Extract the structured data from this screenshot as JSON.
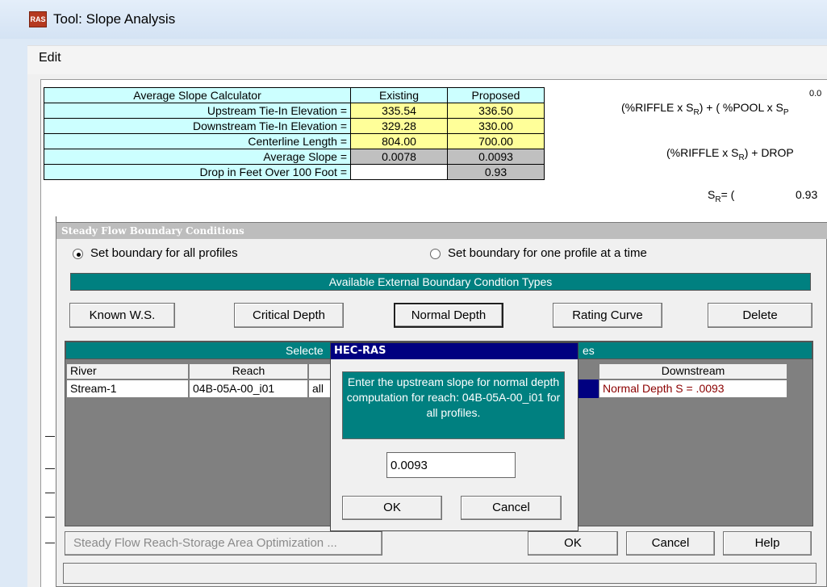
{
  "window": {
    "title": "Tool: Slope Analysis",
    "icon_label": "RAS"
  },
  "menu": {
    "edit": "Edit"
  },
  "calculator": {
    "header": "Average Slope Calculator",
    "col_existing": "Existing",
    "col_proposed": "Proposed",
    "rows": [
      {
        "label": "Upstream Tie-In Elevation =",
        "existing": "335.54",
        "proposed": "336.50"
      },
      {
        "label": "Downstream Tie-In Elevation =",
        "existing": "329.28",
        "proposed": "330.00"
      },
      {
        "label": "Centerline Length =",
        "existing": "804.00",
        "proposed": "700.00"
      },
      {
        "label": "Average Slope =",
        "existing": "0.0078",
        "proposed": "0.0093"
      },
      {
        "label": "Drop in Feet Over 100 Foot =",
        "existing": "",
        "proposed": "0.93"
      }
    ],
    "formula_top": "0.0",
    "formula1": "(%RIFFLE x S",
    "formula1b": ") + ( %POOL x S",
    "formula2": "(%RIFFLE x S",
    "formula2b": ") + DROP",
    "formula3": "S",
    "formula3b": "= (",
    "formula3_value": "0.93",
    "sub_r": "R",
    "sub_p": "P"
  },
  "steady_flow": {
    "title": "Steady Flow Boundary Conditions",
    "radio_all": "Set boundary for all profiles",
    "radio_one": "Set boundary for one profile at a time",
    "types_header": "Available External Boundary Condtion Types",
    "buttons": {
      "known_ws": "Known W.S.",
      "critical_depth": "Critical Depth",
      "normal_depth": "Normal Depth",
      "rating_curve": "Rating Curve",
      "delete": "Delete"
    },
    "selected_header_left": "Selecte",
    "selected_header_right": "es",
    "grid": {
      "col_river": "River",
      "col_reach": "Reach",
      "col_downstream": "Downstream",
      "row": {
        "river": "Stream-1",
        "reach": "04B-05A-00_i01",
        "profile": "all",
        "downstream": "Normal Depth S = .0093"
      }
    },
    "optimization_button": "Steady Flow Reach-Storage Area Optimization ...",
    "ok": "OK",
    "cancel": "Cancel",
    "help": "Help"
  },
  "hecras_dialog": {
    "title": "HEC-RAS",
    "message": "Enter the upstream slope for normal depth computation for reach: 04B-05A-00_i01   for all profiles.",
    "input_value": "0.0093",
    "ok": "OK",
    "cancel": "Cancel"
  },
  "colors": {
    "teal": "#008080",
    "navy_title": "#000080",
    "cell_cyan": "#ccffff",
    "cell_yellow": "#ffff99",
    "downstream_text": "#8b0000"
  }
}
